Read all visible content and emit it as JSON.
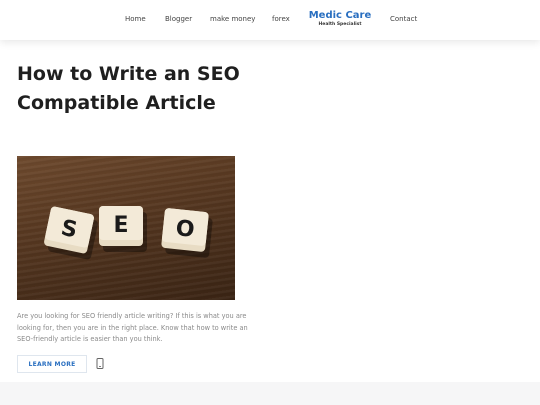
{
  "nav": {
    "items": [
      {
        "label": "Home"
      },
      {
        "label": "Blogger"
      },
      {
        "label": "make money"
      },
      {
        "label": "forex"
      },
      {
        "label": "Contact"
      }
    ]
  },
  "brand": {
    "name": "Medic Care",
    "tagline": "Health Specialist",
    "color": "#2a6fc0"
  },
  "article": {
    "title": "How to Write an SEO Compatible Article",
    "image_tiles": [
      "S",
      "E",
      "O"
    ],
    "excerpt": "Are you looking for SEO friendly article writing? If this is what you are looking for, then you are in the right place. Know that how to write an SEO-friendly article is easier than you think.",
    "learn_more_label": "LEARN MORE",
    "share_icon": "mobile-share-icon"
  }
}
